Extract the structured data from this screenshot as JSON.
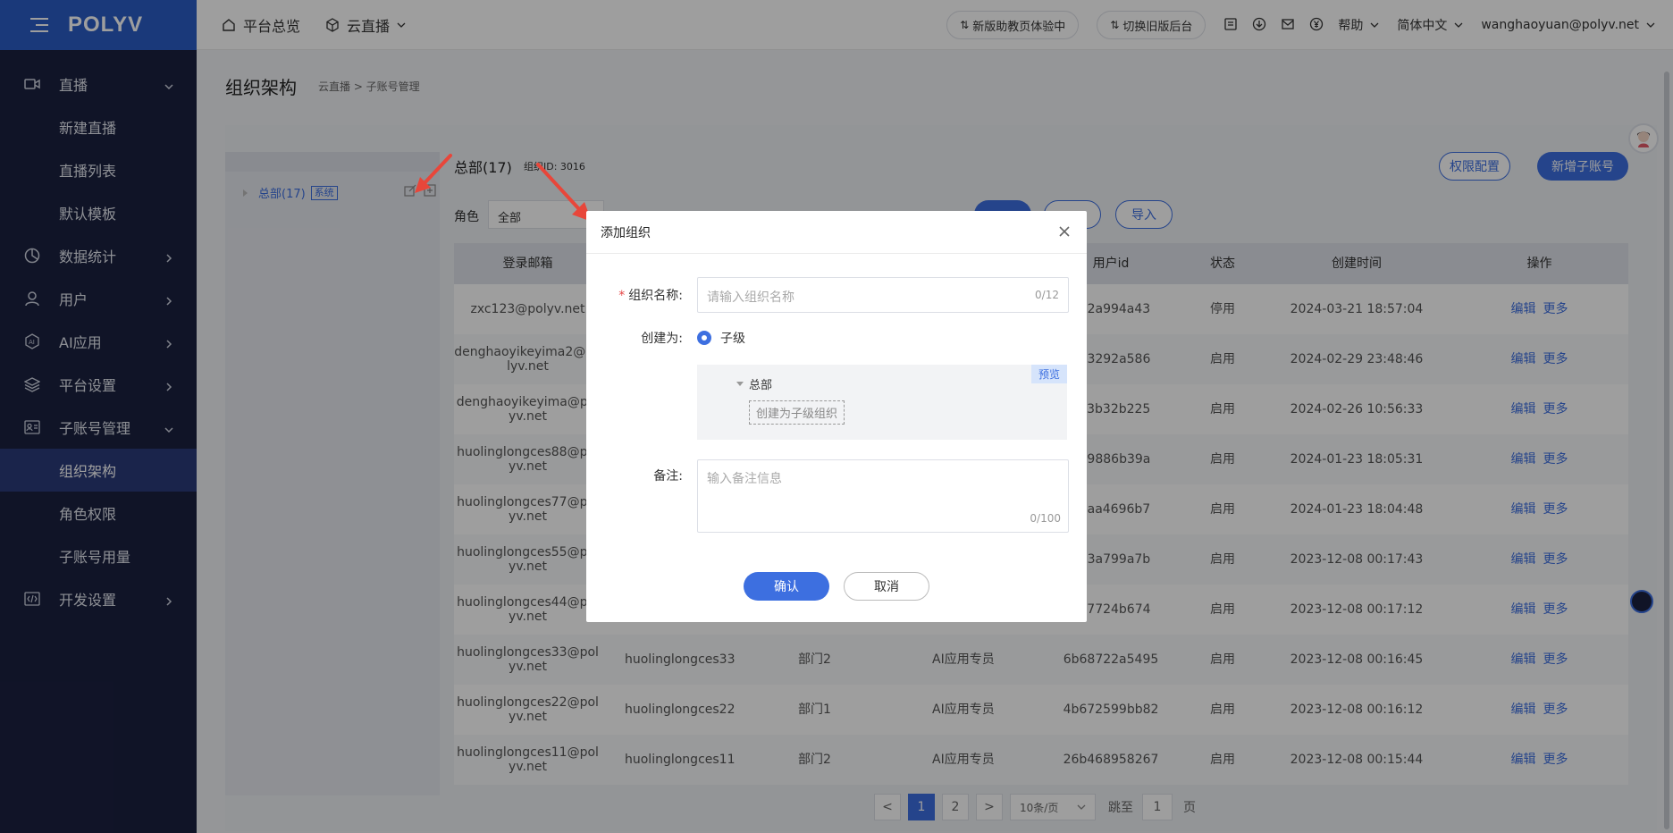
{
  "logo": "POLYV",
  "header": {
    "nav": [
      "平台总览",
      "云直播"
    ],
    "pills": [
      "新版助教页体验中",
      "切换旧版后台"
    ],
    "help": "帮助",
    "language": "简体中文",
    "user": "wanghaoyuan@polyv.net"
  },
  "sidebar": {
    "items": [
      {
        "label": "直播",
        "icon": "video-icon",
        "expanded": true
      },
      {
        "label": "新建直播",
        "sub": true
      },
      {
        "label": "直播列表",
        "sub": true
      },
      {
        "label": "默认模板",
        "sub": true
      },
      {
        "label": "数据统计",
        "icon": "chart-icon"
      },
      {
        "label": "用户",
        "icon": "user-icon"
      },
      {
        "label": "AI应用",
        "icon": "ai-icon"
      },
      {
        "label": "平台设置",
        "icon": "layers-icon"
      },
      {
        "label": "子账号管理",
        "icon": "id-card-icon",
        "expanded": true
      },
      {
        "label": "组织架构",
        "sub": true,
        "active": true
      },
      {
        "label": "角色权限",
        "sub": true
      },
      {
        "label": "子账号用量",
        "sub": true
      },
      {
        "label": "开发设置",
        "icon": "code-icon"
      }
    ]
  },
  "page": {
    "title": "组织架构",
    "breadcrumb": "云直播 >  子账号管理",
    "tree_node": "总部(17)",
    "tree_badge": "系统",
    "org_title": "总部(17)",
    "org_id": "组织ID: 3016",
    "btn_permissions": "权限配置",
    "btn_add_sub": "新增子账号",
    "btn_import": "导入",
    "filter_label": "角色",
    "filter_value": "全部"
  },
  "table": {
    "headers": [
      "登录邮箱",
      "",
      "",
      "",
      "用户id",
      "状态",
      "创建时间",
      "操作"
    ],
    "rows": [
      {
        "email": "zxc123@polyv.net",
        "name": "",
        "dept": "",
        "role": "",
        "uid": "6b2a994a43",
        "status": "停用",
        "created": "2024-03-21 18:57:04"
      },
      {
        "email": "denghaoyikeyima2@polyv.net",
        "name": "",
        "dept": "",
        "role": "",
        "uid": "533292a586",
        "status": "启用",
        "created": "2024-02-29 23:48:46"
      },
      {
        "email": "denghaoyikeyima@polyv.net",
        "name": "",
        "dept": "",
        "role": "",
        "uid": "a33b32b225",
        "status": "启用",
        "created": "2024-02-26 10:56:33"
      },
      {
        "email": "huolinglongces88@polyv.net",
        "name": "",
        "dept": "",
        "role": "",
        "uid": "b99886b39a",
        "status": "启用",
        "created": "2024-01-23 18:05:31"
      },
      {
        "email": "huolinglongces77@polyv.net",
        "name": "",
        "dept": "",
        "role": "",
        "uid": "74aa4696b7",
        "status": "启用",
        "created": "2024-01-23 18:04:48"
      },
      {
        "email": "huolinglongces55@polyv.net",
        "name": "",
        "dept": "",
        "role": "",
        "uid": "9b3a799a7b",
        "status": "启用",
        "created": "2023-12-08 00:17:43"
      },
      {
        "email": "huolinglongces44@polyv.net",
        "name": "",
        "dept": "",
        "role": "",
        "uid": "957724b674",
        "status": "启用",
        "created": "2023-12-08 00:17:12"
      },
      {
        "email": "huolinglongces33@polyv.net",
        "name": "huolinglongces33",
        "dept": "部门2",
        "role": "AI应用专员",
        "uid": "6b68722a5495",
        "status": "启用",
        "created": "2023-12-08 00:16:45"
      },
      {
        "email": "huolinglongces22@polyv.net",
        "name": "huolinglongces22",
        "dept": "部门1",
        "role": "AI应用专员",
        "uid": "4b672599bb82",
        "status": "启用",
        "created": "2023-12-08 00:16:12"
      },
      {
        "email": "huolinglongces11@polyv.net",
        "name": "huolinglongces11",
        "dept": "部门2",
        "role": "AI应用专员",
        "uid": "26b468958267",
        "status": "启用",
        "created": "2023-12-08 00:15:44"
      }
    ],
    "op_edit": "编辑",
    "op_more": "更多"
  },
  "pager": {
    "prev": "<",
    "pages": [
      "1",
      "2"
    ],
    "next": ">",
    "size": "10条/页",
    "goto_label": "跳至",
    "goto_value": "1",
    "page_unit": "页"
  },
  "dialog": {
    "title": "添加组织",
    "name_label": "组织名称:",
    "name_placeholder": "请输入组织名称",
    "name_count": "0/12",
    "create_as_label": "创建为:",
    "create_as_option": "子级",
    "preview_tag": "预览",
    "preview_root": "总部",
    "preview_child": "创建为子级组织",
    "note_label": "备注:",
    "note_placeholder": "输入备注信息",
    "note_count": "0/100",
    "ok": "确认",
    "cancel": "取消"
  }
}
